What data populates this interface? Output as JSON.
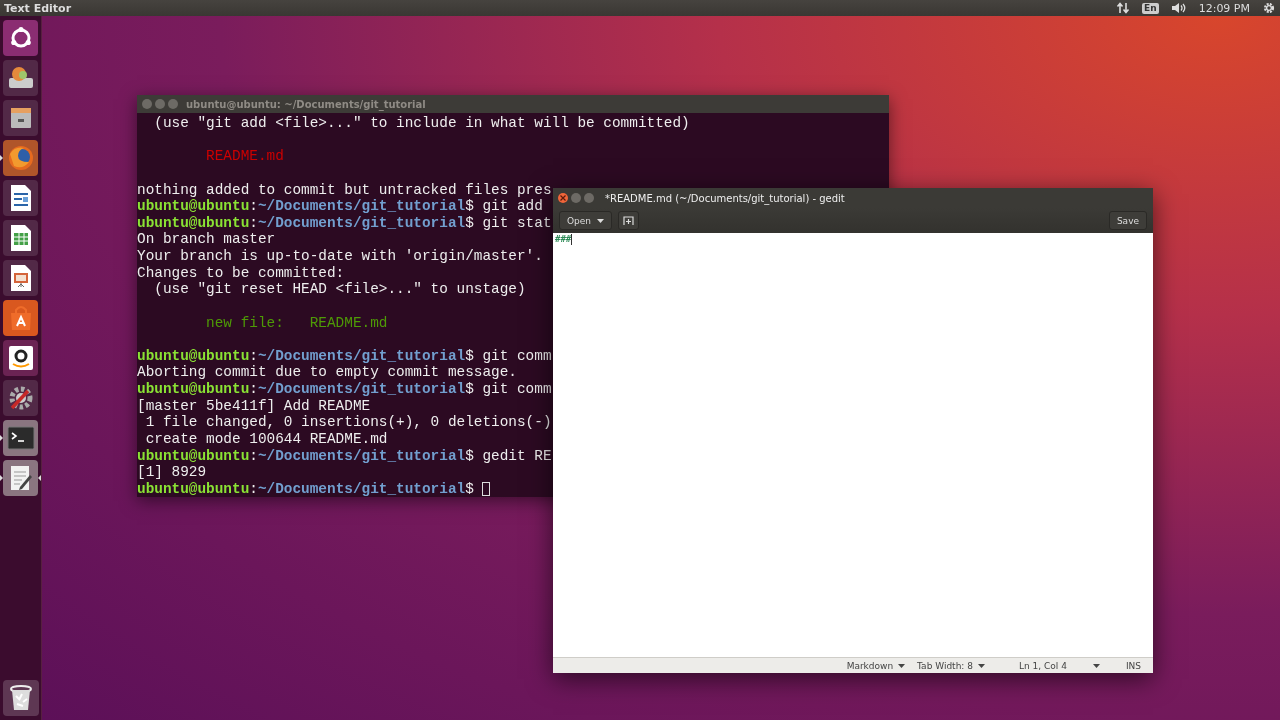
{
  "top_panel": {
    "app_title": "Text Editor",
    "keyboard_layout": "En",
    "time": "12:09 PM"
  },
  "launcher": [
    {
      "kind": "dash",
      "running": false,
      "focused": false
    },
    {
      "kind": "drive",
      "running": false,
      "focused": false
    },
    {
      "kind": "cabinet",
      "running": false,
      "focused": false
    },
    {
      "kind": "globe",
      "running": true,
      "focused": false
    },
    {
      "kind": "writer",
      "running": false,
      "focused": false
    },
    {
      "kind": "calc",
      "running": false,
      "focused": false
    },
    {
      "kind": "impress",
      "running": false,
      "focused": false
    },
    {
      "kind": "bag",
      "running": false,
      "focused": false
    },
    {
      "kind": "shop",
      "running": false,
      "focused": false
    },
    {
      "kind": "settings",
      "running": false,
      "focused": false
    },
    {
      "kind": "terminal",
      "running": true,
      "focused": false
    },
    {
      "kind": "editor",
      "running": true,
      "focused": true
    }
  ],
  "terminal": {
    "title": "ubuntu@ubuntu: ~/Documents/git_tutorial",
    "lines": [
      {
        "kind": "output",
        "text": "  (use \"git add <file>...\" to include in what will be committed)"
      },
      {
        "kind": "blank"
      },
      {
        "kind": "removed",
        "text": "        README.md"
      },
      {
        "kind": "blank"
      },
      {
        "kind": "output",
        "text": "nothing added to commit but untracked files pres"
      },
      {
        "kind": "prompt",
        "user": "ubuntu@ubuntu",
        "colon": ":",
        "path": "~/Documents/git_tutorial",
        "command": "$ git add"
      },
      {
        "kind": "prompt",
        "user": "ubuntu@ubuntu",
        "colon": ":",
        "path": "~/Documents/git_tutorial",
        "command": "$ git stat"
      },
      {
        "kind": "output",
        "text": "On branch master"
      },
      {
        "kind": "output",
        "text": "Your branch is up-to-date with 'origin/master'."
      },
      {
        "kind": "output",
        "text": "Changes to be committed:"
      },
      {
        "kind": "output",
        "text": "  (use \"git reset HEAD <file>...\" to unstage)"
      },
      {
        "kind": "blank"
      },
      {
        "kind": "added",
        "text": "        new file:   README.md"
      },
      {
        "kind": "blank"
      },
      {
        "kind": "prompt",
        "user": "ubuntu@ubuntu",
        "colon": ":",
        "path": "~/Documents/git_tutorial",
        "command": "$ git comm"
      },
      {
        "kind": "output",
        "text": "Aborting commit due to empty commit message."
      },
      {
        "kind": "prompt",
        "user": "ubuntu@ubuntu",
        "colon": ":",
        "path": "~/Documents/git_tutorial",
        "command": "$ git comm"
      },
      {
        "kind": "output",
        "text": "[master 5be411f] Add README"
      },
      {
        "kind": "output",
        "text": " 1 file changed, 0 insertions(+), 0 deletions(-)"
      },
      {
        "kind": "output",
        "text": " create mode 100644 README.md"
      },
      {
        "kind": "prompt",
        "user": "ubuntu@ubuntu",
        "colon": ":",
        "path": "~/Documents/git_tutorial",
        "command": "$ gedit RE"
      },
      {
        "kind": "output",
        "text": "[1] 8929"
      },
      {
        "kind": "prompt",
        "user": "ubuntu@ubuntu",
        "colon": ":",
        "path": "~/Documents/git_tutorial",
        "command": "$",
        "cursor": true
      }
    ]
  },
  "gedit": {
    "title": "*README.md (~/Documents/git_tutorial) - gedit",
    "open_button": "Open",
    "save_button": "Save",
    "document_text": "###",
    "status_bar": {
      "language": "Markdown",
      "tab_width": "Tab Width: 8",
      "position": "Ln 1, Col 4",
      "mode": "INS"
    }
  }
}
